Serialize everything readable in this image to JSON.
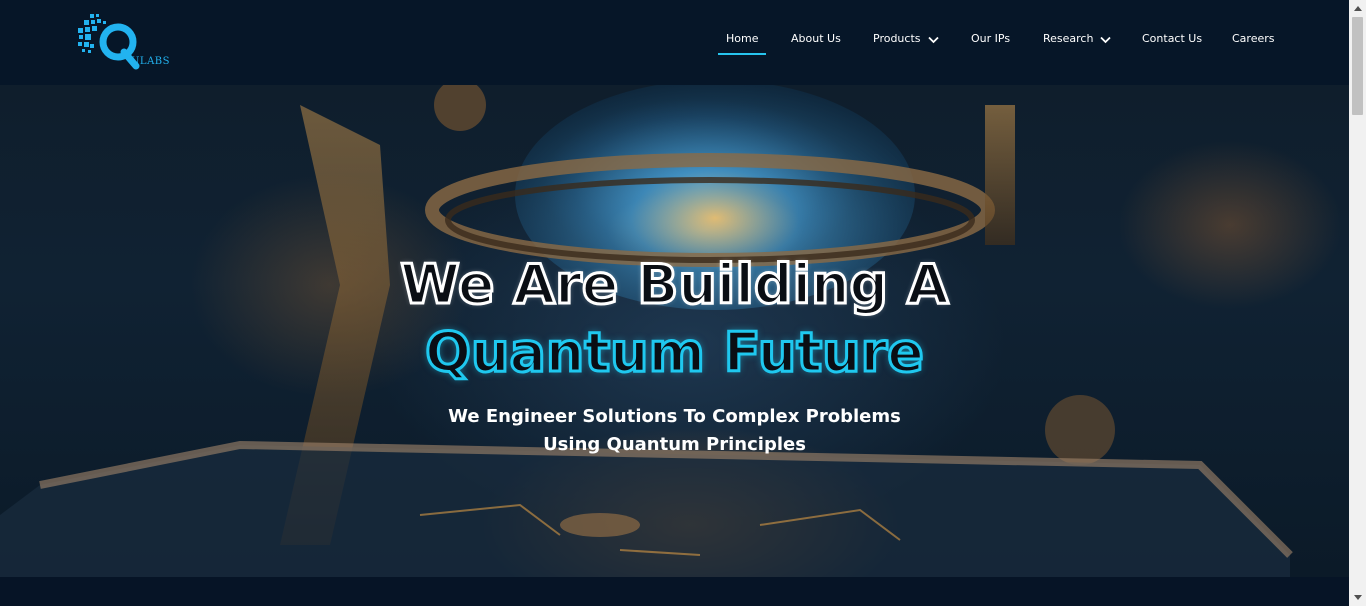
{
  "brand": {
    "logo_text": "ULABS",
    "logo_color": "#22b3f0"
  },
  "nav": {
    "items": [
      {
        "label": "Home",
        "active": true
      },
      {
        "label": "About Us"
      },
      {
        "label": "Products",
        "has_dropdown": true
      },
      {
        "label": "Our IPs"
      },
      {
        "label": "Research",
        "has_dropdown": true
      },
      {
        "label": "Contact Us"
      },
      {
        "label": "Careers"
      }
    ]
  },
  "hero": {
    "title_line1": "We Are Building A",
    "title_line2": "Quantum Future",
    "subtitle_line1": "We Engineer Solutions To Complex Problems",
    "subtitle_line2": "Using Quantum Principles",
    "accent_color": "#1fc8ef"
  },
  "icons": [
    "chevron-down-icon",
    "scroll-up-arrow-icon",
    "scroll-down-arrow-icon",
    "qulabs-logo-icon"
  ]
}
